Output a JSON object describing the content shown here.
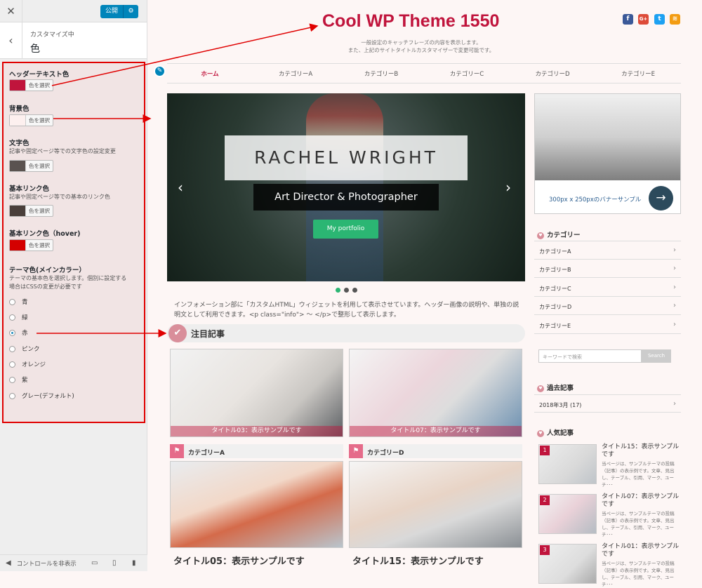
{
  "sidebar": {
    "publish_label": "公開",
    "subtitle": "カスタマイズ中",
    "section_title": "色",
    "controls": [
      {
        "label": "ヘッダーテキスト色",
        "button": "色を選択",
        "color": "#c0143c"
      },
      {
        "label": "背景色",
        "button": "色を選択",
        "color": "#fdf0ef"
      },
      {
        "label": "文字色",
        "desc": "記事や固定ページ等での文字色の設定変更",
        "button": "色を選択",
        "color": "#5a5350"
      },
      {
        "label": "基本リンク色",
        "desc": "記事や固定ページ等での基本のリンク色",
        "button": "色を選択",
        "color": "#4a3f3b"
      },
      {
        "label": "基本リンク色（hover)",
        "button": "色を選択",
        "color": "#d40000"
      }
    ],
    "theme": {
      "label": "テーマ色(メインカラー）",
      "desc1": "テーマの基本色を選択します。個別に設定する",
      "desc2": "場合はCSSの変更が必要です",
      "options": [
        "青",
        "緑",
        "赤",
        "ピンク",
        "オレンジ",
        "紫",
        "グレー(デフォルト)"
      ],
      "selected": "赤"
    },
    "footer_label": "コントロールを非表示"
  },
  "site": {
    "title": "Cool WP Theme 1550",
    "caption1": "一般設定のキャッチフレーズの内容を表示します。",
    "caption2": "また、上記のサイトタイトルカスタマイザーで変更可能です。",
    "social": [
      {
        "icon": "facebook-icon",
        "glyph": "f",
        "color": "#3b5998"
      },
      {
        "icon": "google-plus-icon",
        "glyph": "G+",
        "color": "#dd4b39"
      },
      {
        "icon": "twitter-icon",
        "glyph": "t",
        "color": "#1da1f2"
      },
      {
        "icon": "rss-icon",
        "glyph": "≋",
        "color": "#f39c12"
      }
    ],
    "nav": [
      "ホーム",
      "カテゴリーA",
      "カテゴリーB",
      "カテゴリーC",
      "カテゴリーD",
      "カテゴリーE"
    ],
    "accent": "#c0143c",
    "slider": {
      "name": "RACHEL WRIGHT",
      "subtitle": "Art Director & Photographer",
      "button": "My portfolio"
    },
    "info": "インフォメーション部に「カスタムHTML」ウィジェットを利用して表示させています。ヘッダー画像の説明や、単独の説明文として利用できます。<p class=\"info\"> 〜 </p>で整形して表示します。",
    "featured_title": "注目記事",
    "featured": [
      "タイトル03：表示サンプルです",
      "タイトル07：表示サンプルです"
    ],
    "categories": [
      {
        "name": "カテゴリーA",
        "post": "タイトル05：表示サンプルです"
      },
      {
        "name": "カテゴリーD",
        "post": "タイトル15：表示サンプルです"
      }
    ],
    "banner_text": "300px x 250pxのバナーサンプル",
    "widget_cat_title": "カテゴリー",
    "widget_cats": [
      "カテゴリーA",
      "カテゴリーB",
      "カテゴリーC",
      "カテゴリーD",
      "カテゴリーE"
    ],
    "search_placeholder": "キーワードで検索",
    "search_button": "Search",
    "archive_title": "過去記事",
    "archive_item": "2018年3月 (17)",
    "popular_title": "人気記事",
    "popular": [
      {
        "rank": "1",
        "title": "タイトル15：表示サンプルです",
        "desc": "当ページは、サンプルテーマの投稿（記事）の表示例です。文章、見出し、テーブル、引用、マーク、ユーチ･･･"
      },
      {
        "rank": "2",
        "title": "タイトル07：表示サンプルです",
        "desc": "当ページは、サンプルテーマの投稿（記事）の表示例です。文章、見出し、テーブル、引用、マーク、ユーチ･･･"
      },
      {
        "rank": "3",
        "title": "タイトル01：表示サンプルです",
        "desc": "当ページは、サンプルテーマの投稿（記事）の表示例です。文章、見出し、テーブル、引用、マーク、ユーチ･･･"
      }
    ]
  }
}
